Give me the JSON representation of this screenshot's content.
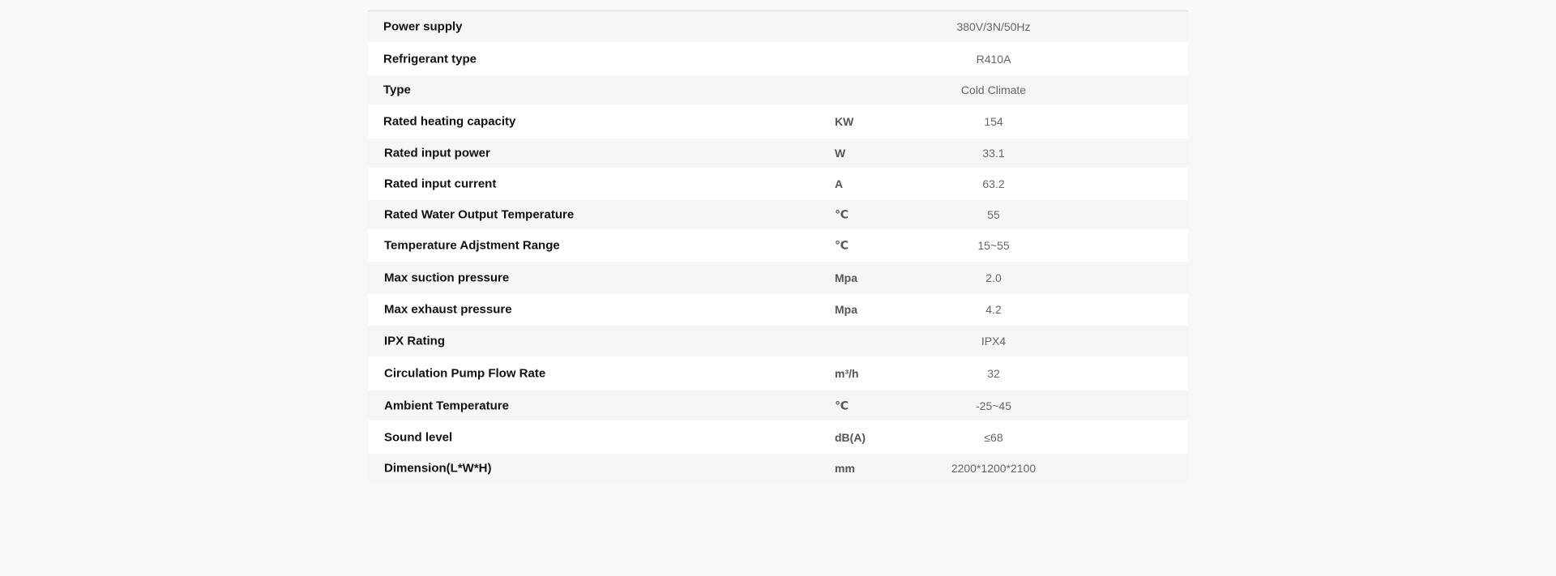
{
  "specs": {
    "rows": [
      {
        "param": "Power supply",
        "unit": "",
        "value": "380V/3N/50Hz"
      },
      {
        "param": "Refrigerant type",
        "unit": "",
        "value": "R410A"
      },
      {
        "param": "Type",
        "unit": "",
        "value": "Cold Climate"
      },
      {
        "param": "Rated heating capacity",
        "unit": "KW",
        "value": "154"
      },
      {
        "param": "Rated input power",
        "unit": "W",
        "value": "33.1"
      },
      {
        "param": "Rated input current",
        "unit": "A",
        "value": "63.2"
      },
      {
        "param": "Rated Water Output Temperature",
        "unit": "℃",
        "value": "55"
      },
      {
        "param": "Temperature Adjstment Range",
        "unit": "℃",
        "value": "15~55"
      },
      {
        "param": "Max suction pressure",
        "unit": "Mpa",
        "value": "2.0"
      },
      {
        "param": "Max exhaust pressure",
        "unit": "Mpa",
        "value": "4.2"
      },
      {
        "param": "IPX Rating",
        "unit": "",
        "value": "IPX4"
      },
      {
        "param": "Circulation Pump Flow Rate",
        "unit": "m³/h",
        "value": "32"
      },
      {
        "param": "Ambient Temperature",
        "unit": "℃",
        "value": "-25~45"
      },
      {
        "param": "Sound level",
        "unit": "dB(A)",
        "value": "≤68"
      },
      {
        "param": "Dimension(L*W*H)",
        "unit": "mm",
        "value": "2200*1200*2100"
      }
    ]
  }
}
